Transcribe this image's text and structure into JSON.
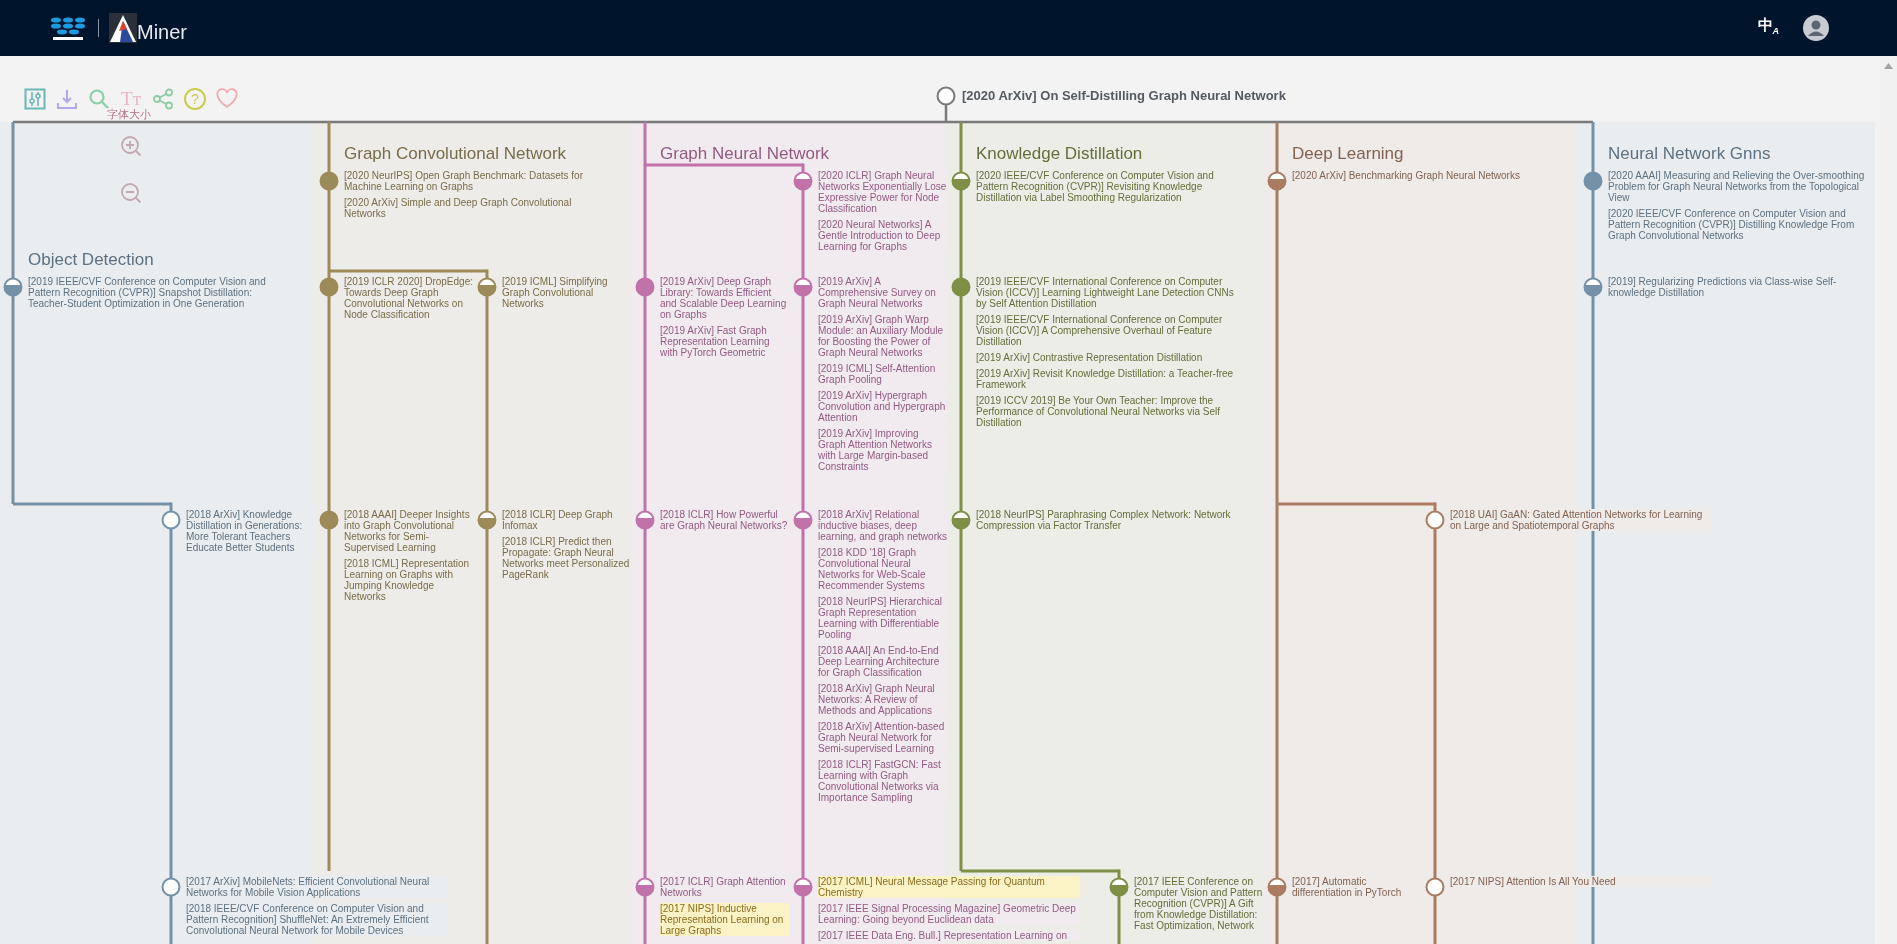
{
  "header": {
    "brand": "Miner",
    "language": {
      "label": "中",
      "sub": "A"
    }
  },
  "toolbar": {
    "font_glyph": "Tт",
    "font_label": "字体大小",
    "help_glyph": "?"
  },
  "root": {
    "title": "[2020 ArXiv] On Self-Distilling Graph Neural Network"
  },
  "columns": [
    {
      "title": "Object Detection",
      "color": "#7491a8",
      "lanes": [
        {
          "extends": false,
          "slots": [
            {
              "kind": "empty"
            },
            {
              "kind": "half",
              "papers": [
                {
                  "text": "[2019 IEEE/CVF Conference on Computer Vision and Pattern Recognition (CVPR)] Snapshot Distillation: Teacher-Student Optimization in One Generation",
                  "highlighted": false
                }
              ]
            }
          ]
        },
        {
          "extends": true,
          "slots": [
            {
              "kind": "empty"
            },
            {
              "kind": "empty"
            },
            {
              "kind": "hollow",
              "papers": [
                {
                  "text": "[2018 ArXiv] Knowledge Distillation in Generations: More Tolerant Teachers Educate Better Students",
                  "highlighted": false
                }
              ]
            },
            {
              "kind": "hollow",
              "papers": [
                {
                  "text": "[2017 ArXiv] MobileNets: Efficient Convolutional Neural Networks for Mobile Vision Applications",
                  "highlighted": false
                },
                {
                  "text": "[2018 IEEE/CVF Conference on Computer Vision and Pattern Recognition] ShuffleNet: An Extremely Efficient Convolutional Neural Network for Mobile Devices",
                  "highlighted": false
                }
              ]
            }
          ]
        }
      ]
    },
    {
      "title": "Graph Convolutional Network",
      "color": "#9c8a58",
      "lanes": [
        {
          "extends": false,
          "slots": [
            {
              "kind": "filled",
              "papers": [
                {
                  "text": "[2020 NeurIPS] Open Graph Benchmark: Datasets for Machine Learning on Graphs",
                  "highlighted": false
                },
                {
                  "text": "[2020 ArXiv] Simple and Deep Graph Convolutional Networks",
                  "highlighted": false
                }
              ]
            },
            {
              "kind": "filled",
              "papers": [
                {
                  "text": "[2019 ICLR 2020] DropEdge: Towards Deep Graph Convolutional Networks on Node Classification",
                  "highlighted": false
                }
              ]
            },
            {
              "kind": "filled",
              "papers": [
                {
                  "text": "[2018 AAAI] Deeper Insights into Graph Convolutional Networks for Semi-Supervised Learning",
                  "highlighted": false
                },
                {
                  "text": "[2018 ICML] Representation Learning on Graphs with Jumping Knowledge Networks",
                  "highlighted": false
                }
              ]
            }
          ]
        },
        {
          "extends": true,
          "slots": [
            {
              "kind": "empty"
            },
            {
              "kind": "half",
              "papers": [
                {
                  "text": "[2019 ICML] Simplifying Graph Convolutional Networks",
                  "highlighted": false
                }
              ]
            },
            {
              "kind": "half",
              "papers": [
                {
                  "text": "[2018 ICLR] Deep Graph Infomax",
                  "highlighted": false
                },
                {
                  "text": "[2018 ICLR] Predict then Propagate: Graph Neural Networks meet Personalized PageRank",
                  "highlighted": false
                }
              ]
            }
          ]
        }
      ]
    },
    {
      "title": "Graph Neural Network",
      "color": "#c172a9",
      "lanes": [
        {
          "extends": true,
          "slots": [
            {
              "kind": "empty"
            },
            {
              "kind": "filled",
              "papers": [
                {
                  "text": "[2019 ArXiv] Deep Graph Library: Towards Efficient and Scalable Deep Learning on Graphs",
                  "highlighted": false
                },
                {
                  "text": "[2019 ArXiv] Fast Graph Representation Learning with PyTorch Geometric",
                  "highlighted": false
                }
              ]
            },
            {
              "kind": "half",
              "papers": [
                {
                  "text": "[2018 ICLR] How Powerful are Graph Neural Networks?",
                  "highlighted": false
                }
              ]
            },
            {
              "kind": "half",
              "papers": [
                {
                  "text": "[2017 ICLR] Graph Attention Networks",
                  "highlighted": false
                },
                {
                  "text": "[2017 NIPS] Inductive Representation Learning on Large Graphs",
                  "highlighted": true
                }
              ]
            }
          ]
        },
        {
          "extends": true,
          "slots": [
            {
              "kind": "half",
              "papers": [
                {
                  "text": "[2020 ICLR] Graph Neural Networks Exponentially Lose Expressive Power for Node Classification",
                  "highlighted": false
                },
                {
                  "text": "[2020 Neural Networks] A Gentle Introduction to Deep Learning for Graphs",
                  "highlighted": false
                }
              ]
            },
            {
              "kind": "half",
              "papers": [
                {
                  "text": "[2019 ArXiv] A Comprehensive Survey on Graph Neural Networks",
                  "highlighted": false
                },
                {
                  "text": "[2019 ArXiv] Graph Warp Module: an Auxiliary Module for Boosting the Power of Graph Neural Networks",
                  "highlighted": false
                },
                {
                  "text": "[2019 ICML] Self-Attention Graph Pooling",
                  "highlighted": false
                },
                {
                  "text": "[2019 ArXiv] Hypergraph Convolution and Hypergraph Attention",
                  "highlighted": false
                },
                {
                  "text": "[2019 ArXiv] Improving Graph Attention Networks with Large Margin-based Constraints",
                  "highlighted": false
                }
              ]
            },
            {
              "kind": "half",
              "papers": [
                {
                  "text": "[2018 ArXiv] Relational inductive biases, deep learning, and graph networks",
                  "highlighted": false
                },
                {
                  "text": "[2018 KDD '18] Graph Convolutional Neural Networks for Web-Scale Recommender Systems",
                  "highlighted": false
                },
                {
                  "text": "[2018 NeurIPS] Hierarchical Graph Representation Learning with Differentiable Pooling",
                  "highlighted": false
                },
                {
                  "text": "[2018 AAAI] An End-to-End Deep Learning Architecture for Graph Classification",
                  "highlighted": false
                },
                {
                  "text": "[2018 ArXiv] Graph Neural Networks: A Review of Methods and Applications",
                  "highlighted": false
                },
                {
                  "text": "[2018 ArXiv] Attention-based Graph Neural Network for Semi-supervised Learning",
                  "highlighted": false
                },
                {
                  "text": "[2018 ICLR] FastGCN: Fast Learning with Graph Convolutional Networks via Importance Sampling",
                  "highlighted": false
                }
              ]
            },
            {
              "kind": "half",
              "papers": [
                {
                  "text": "[2017 ICML] Neural Message Passing for Quantum Chemistry",
                  "highlighted": true
                },
                {
                  "text": "[2017 IEEE Signal Processing Magazine] Geometric Deep Learning: Going beyond Euclidean data",
                  "highlighted": false
                },
                {
                  "text": "[2017 IEEE Data Eng. Bull.] Representation Learning on",
                  "highlighted": false
                }
              ]
            }
          ]
        }
      ]
    },
    {
      "title": "Knowledge Distillation",
      "color": "#7f8f45",
      "lanes": [
        {
          "extends": false,
          "slots": [
            {
              "kind": "half",
              "papers": [
                {
                  "text": "[2020 IEEE/CVF Conference on Computer Vision and Pattern Recognition (CVPR)] Revisiting Knowledge Distillation via Label Smoothing Regularization",
                  "highlighted": false
                }
              ]
            },
            {
              "kind": "filled",
              "papers": [
                {
                  "text": "[2019 IEEE/CVF International Conference on Computer Vision (ICCV)] Learning Lightweight Lane Detection CNNs by Self Attention Distillation",
                  "highlighted": false
                },
                {
                  "text": "[2019 IEEE/CVF International Conference on Computer Vision (ICCV)] A Comprehensive Overhaul of Feature Distillation",
                  "highlighted": false
                },
                {
                  "text": "[2019 ArXiv] Contrastive Representation Distillation",
                  "highlighted": false
                },
                {
                  "text": "[2019 ArXiv] Revisit Knowledge Distillation: a Teacher-free Framework",
                  "highlighted": false
                },
                {
                  "text": "[2019 ICCV 2019] Be Your Own Teacher: Improve the Performance of Convolutional Neural Networks via Self Distillation",
                  "highlighted": false
                }
              ]
            },
            {
              "kind": "half",
              "papers": [
                {
                  "text": "[2018 NeurIPS] Paraphrasing Complex Network: Network Compression via Factor Transfer",
                  "highlighted": false
                }
              ]
            }
          ]
        },
        {
          "extends": true,
          "slots": [
            {
              "kind": "empty"
            },
            {
              "kind": "empty"
            },
            {
              "kind": "empty"
            },
            {
              "kind": "half",
              "papers": [
                {
                  "text": "[2017 IEEE Conference on Computer Vision and Pattern Recognition (CVPR)] A Gift from Knowledge Distillation: Fast Optimization, Network",
                  "highlighted": false
                }
              ]
            }
          ]
        }
      ]
    },
    {
      "title": "Deep Learning",
      "color": "#aa7c62",
      "lanes": [
        {
          "extends": true,
          "slots": [
            {
              "kind": "half",
              "papers": [
                {
                  "text": "[2020 ArXiv] Benchmarking Graph Neural Networks",
                  "highlighted": false
                }
              ]
            },
            {
              "kind": "empty"
            },
            {
              "kind": "empty"
            },
            {
              "kind": "half",
              "papers": [
                {
                  "text": "[2017] Automatic differentiation in PyTorch",
                  "highlighted": false
                }
              ]
            }
          ]
        },
        {
          "extends": true,
          "slots": [
            {
              "kind": "empty"
            },
            {
              "kind": "empty"
            },
            {
              "kind": "hollow",
              "papers": [
                {
                  "text": "[2018 UAI] GaAN: Gated Attention Networks for Learning on Large and Spatiotemporal Graphs",
                  "highlighted": false
                }
              ]
            },
            {
              "kind": "hollow",
              "papers": [
                {
                  "text": "[2017 NIPS] Attention Is All You Need",
                  "highlighted": false
                }
              ]
            }
          ]
        }
      ]
    },
    {
      "title": "Neural Network Gnns",
      "color": "#7491a8",
      "lanes": [
        {
          "extends": true,
          "slots": [
            {
              "kind": "filled",
              "papers": [
                {
                  "text": "[2020 AAAI] Measuring and Relieving the Over-smoothing Problem for Graph Neural Networks from the Topological View",
                  "highlighted": false
                },
                {
                  "text": "[2020 IEEE/CVF Conference on Computer Vision and Pattern Recognition (CVPR)] Distilling Knowledge From Graph Convolutional Networks",
                  "highlighted": false
                }
              ]
            },
            {
              "kind": "half",
              "papers": [
                {
                  "text": "[2019] Regularizing Predictions via Class-wise Self-knowledge Distillation",
                  "highlighted": false
                }
              ]
            }
          ]
        }
      ]
    }
  ]
}
